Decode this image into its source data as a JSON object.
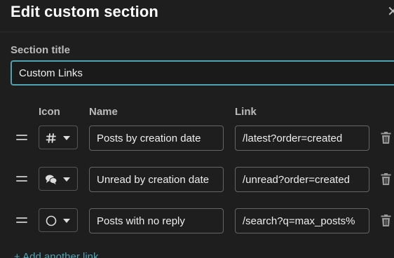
{
  "modal": {
    "title": "Edit custom section",
    "close_icon": "close-icon"
  },
  "section_title": {
    "label": "Section title",
    "value": "Custom Links"
  },
  "columns": {
    "icon": "Icon",
    "name": "Name",
    "link": "Link"
  },
  "links": [
    {
      "icon": "hashtag-icon",
      "name": "Posts by creation date",
      "link": "/latest?order=created"
    },
    {
      "icon": "comments-icon",
      "name": "Unread by creation date",
      "link": "/unread?order=created"
    },
    {
      "icon": "circle-icon",
      "name": "Posts with no reply",
      "link": "/search?q=max_posts%"
    }
  ],
  "add_link": {
    "label": "+ Add another link"
  },
  "colors": {
    "background": "#1e1e1e",
    "accent": "#4fa3b3",
    "text": "#dddddd"
  }
}
